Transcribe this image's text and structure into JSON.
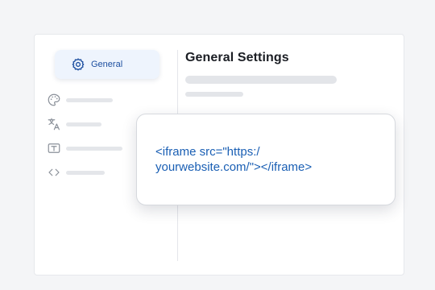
{
  "sidebar": {
    "active_item": {
      "label": "General",
      "icon": "gear-icon"
    },
    "items": [
      {
        "icon": "palette-icon"
      },
      {
        "icon": "translate-icon"
      },
      {
        "icon": "text-box-icon"
      },
      {
        "icon": "code-icon"
      }
    ]
  },
  "main": {
    "title": "General Settings"
  },
  "embed_code": {
    "line1": "<iframe src=\"https:/",
    "line2": "yourwebsite.com/\"></iframe>"
  },
  "colors": {
    "accent": "#1a5fb4",
    "active_bg": "#eef4fd",
    "placeholder": "#e4e6ea"
  }
}
